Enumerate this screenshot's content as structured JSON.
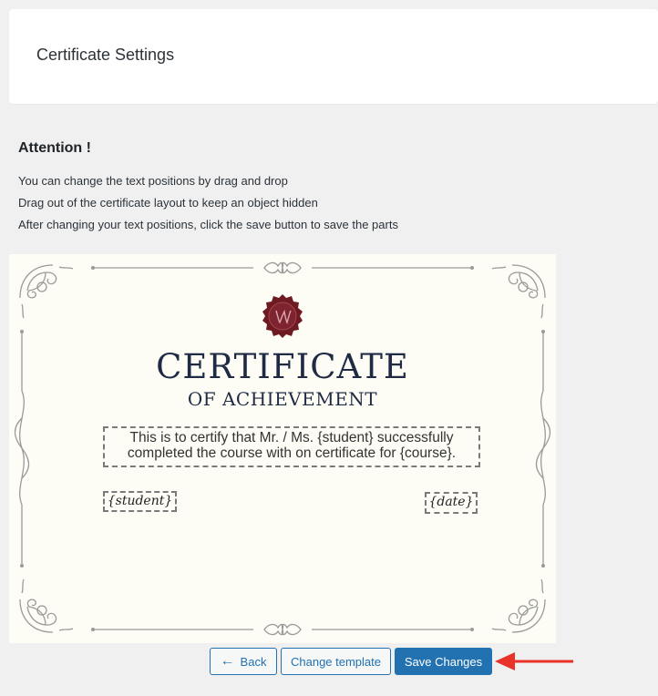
{
  "header": {
    "title": "Certificate Settings"
  },
  "notice": {
    "heading": "Attention !",
    "lines": [
      "You can change the text positions by drag and drop",
      "Drag out of the certificate layout to keep an object hidden",
      "After changing your text positions, click the save button to save the parts"
    ]
  },
  "certificate": {
    "title": "CERTIFICATE",
    "subtitle": "OF ACHIEVEMENT",
    "body_line1": "This is to certify that Mr. / Ms. {student} successfully",
    "body_line2": "completed the course with on certificate for {course}.",
    "student_placeholder": "{student}",
    "date_placeholder": "{date}",
    "seal_color": "#6e1a22",
    "text_color": "#1f2a44",
    "background": "#fdfdf5"
  },
  "actions": {
    "back_label": "Back",
    "change_template_label": "Change template",
    "save_label": "Save Changes",
    "accent": "#2271b1",
    "callout_color": "#e8322a"
  }
}
